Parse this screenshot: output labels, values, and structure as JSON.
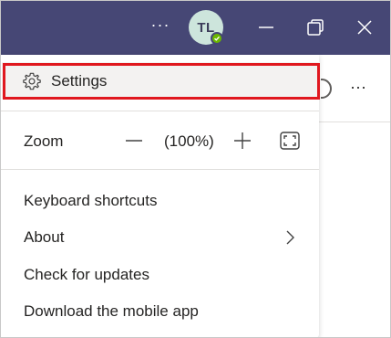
{
  "titlebar": {
    "more_label": "···",
    "avatar_initials": "TL",
    "presence_status": "available",
    "background_color": "#464775"
  },
  "menu": {
    "settings_label": "Settings",
    "zoom": {
      "label": "Zoom",
      "value": "(100%)"
    },
    "items": [
      {
        "label": "Keyboard shortcuts"
      },
      {
        "label": "About"
      },
      {
        "label": "Check for updates"
      },
      {
        "label": "Download the mobile app"
      }
    ],
    "highlight_color": "#e0181f"
  },
  "background": {
    "more_label": "···"
  }
}
